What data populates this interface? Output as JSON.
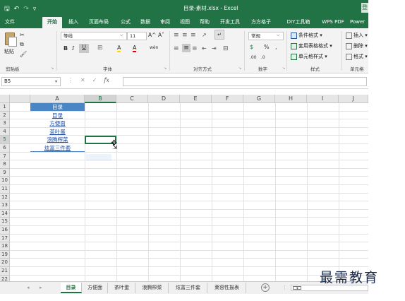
{
  "titlebar": {
    "quick_access": {
      "save": "🖫",
      "undo": "↶",
      "redo": "↷",
      "customize": "▿"
    },
    "title": "目录-素材.xlsx  -  Excel",
    "account": "登"
  },
  "ribbon_tabs": [
    "文件",
    "开始",
    "插入",
    "页面布局",
    "公式",
    "数据",
    "审阅",
    "视图",
    "帮助",
    "开发工具",
    "方方格子",
    "DIY工具箱",
    "WPS PDF",
    "Power"
  ],
  "active_tab": "开始",
  "ribbon": {
    "clipboard": {
      "label": "剪贴板",
      "paste": "粘贴",
      "cut": "✂",
      "copy": "⧉",
      "format_painter": "🖌"
    },
    "font": {
      "label": "字体",
      "font_name": "等线",
      "font_size": "11",
      "grow": "A^",
      "shrink": "A˅",
      "bold": "B",
      "italic": "I",
      "underline": "U",
      "border": "⊞",
      "fill": "A",
      "color": "A",
      "phonetic": "wén"
    },
    "alignment": {
      "label": "对齐方式"
    },
    "number": {
      "label": "数字",
      "format": "常规",
      "percent": "%",
      "comma": ",",
      "inc_dec": ".00",
      "dec_dec": ".0"
    },
    "styles": {
      "label": "样式",
      "conditional": "条件格式 ▾",
      "table": "套用表格格式 ▾",
      "cell": "单元格样式 ▾"
    },
    "cells": {
      "label": "单元格",
      "insert": "插入 ▾",
      "delete": "删除 ▾",
      "format": "格式 ▾"
    }
  },
  "formula_bar": {
    "name_box": "B5",
    "cancel": "✕",
    "confirm": "✓",
    "fx": "fx",
    "value": ""
  },
  "columns": [
    "A",
    "B",
    "C",
    "D",
    "E",
    "F",
    "G",
    "H",
    "I",
    "J"
  ],
  "rows": [
    "1",
    "2",
    "3",
    "4",
    "5",
    "6",
    "7",
    "8",
    "9",
    "10",
    "11",
    "12",
    "13",
    "14",
    "15",
    "16",
    "17",
    "18",
    "19",
    "20",
    "21",
    "22"
  ],
  "selected_cell": {
    "column": "B",
    "row": "5"
  },
  "column_a_cells": [
    "目录",
    "目录",
    "方便面",
    "茶叶蛋",
    "浪腾榨菜",
    "炫富三件套"
  ],
  "sheet_tabs": [
    "目录",
    "方便面",
    "茶叶蛋",
    "浪腾榨菜",
    "炫富三件套",
    "莱容性报表"
  ],
  "active_sheet": "目录",
  "sheet_nav": {
    "prev": "◂",
    "next": "▸",
    "add": "+",
    "more": "⋮"
  },
  "watermark": "最需教育",
  "colors": {
    "excel_green": "#217346",
    "header_blue": "#4a86c5",
    "link_blue": "#1f4fa5"
  }
}
